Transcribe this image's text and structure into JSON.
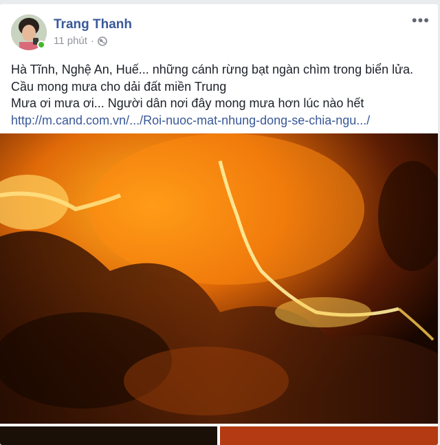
{
  "post": {
    "author": "Trang Thanh",
    "time": "11 phút",
    "separator": "·",
    "privacy_icon": "globe-icon",
    "more_icon": "more-options-icon",
    "more_label": "•••",
    "lines": [
      "Hà Tĩnh, Nghệ An, Huế... những cánh rừng bạt ngàn chìm trong biển lửa.",
      "Cầu mong mưa cho dải đất miền Trung",
      "Mưa ơi mưa ơi... Người dân nơi đây mong mưa hơn lúc nào hết"
    ],
    "link": "http://m.cand.com.vn/.../Roi-nuoc-mat-nhung-dong-se-chia-ngu.../"
  },
  "colors": {
    "author": "#385898",
    "online": "#42b72a",
    "link": "#385898",
    "fire": "#ff9d1a"
  }
}
